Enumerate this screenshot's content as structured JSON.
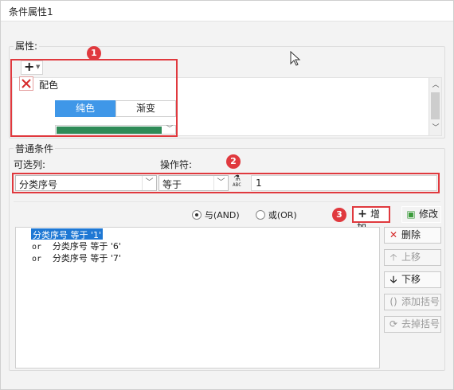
{
  "window": {
    "title": "条件属性1"
  },
  "properties": {
    "group_label": "属性:",
    "add_button": "+",
    "item_label": "配色",
    "tabs": [
      "纯色",
      "渐变"
    ],
    "color_swatch": "#2e8b57",
    "badge": "1"
  },
  "conditions": {
    "group_label": "普通条件",
    "field_label": "可选列:",
    "operator_label": "操作符:",
    "field_value": "分类序号",
    "operator_value": "等于",
    "value_input": "1",
    "badge": "2",
    "radio_and": "与(AND)",
    "radio_or": "或(OR)",
    "add_button": "增加",
    "modify_button": "修改",
    "add_badge": "3",
    "list": [
      {
        "prefix": "",
        "text": "分类序号 等于 '1'",
        "selected": true
      },
      {
        "prefix": "or",
        "text": "分类序号 等于 '6'",
        "selected": false
      },
      {
        "prefix": "or",
        "text": "分类序号 等于 '7'",
        "selected": false
      }
    ],
    "side_buttons": {
      "delete": "删除",
      "up": "上移",
      "down": "下移",
      "add_bracket": "添加括号",
      "remove_bracket": "去掉括号"
    }
  },
  "icons": {
    "add": "plus-icon",
    "close": "x-icon",
    "cursor": "mouse-cursor-icon",
    "formula": "abc-formula-icon",
    "modify": "edit-icon",
    "up": "arrow-up-icon",
    "down": "arrow-down-icon"
  }
}
